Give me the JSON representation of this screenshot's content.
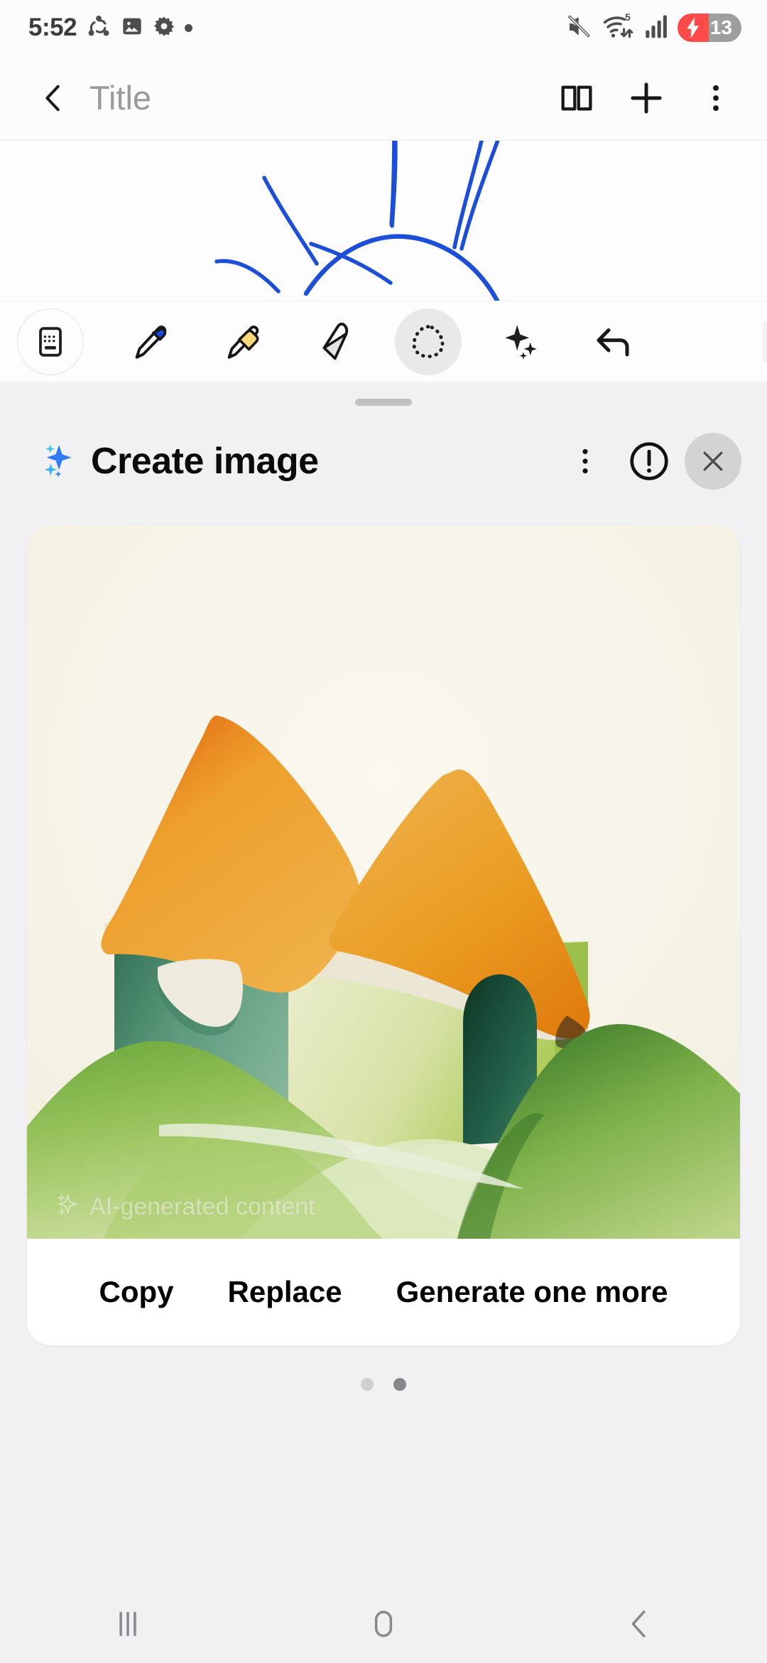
{
  "status_bar": {
    "time": "5:52",
    "left_icons": [
      "share-nodes-icon",
      "gallery-image-icon",
      "settings-gear-icon",
      "dot-indicator-icon"
    ],
    "right_icons": [
      "sound-mute-icon",
      "wifi-icon",
      "cellular-signal-icon"
    ],
    "wifi_level_label": "5",
    "battery": {
      "percent_label": "13",
      "charging": true,
      "accent": "#ff4a4a",
      "pill_bg": "#9e9e9e"
    }
  },
  "app_bar": {
    "back_icon": "chevron-left-icon",
    "title": "Title",
    "actions": [
      {
        "name": "book-view-icon",
        "label": "Book view"
      },
      {
        "name": "add-icon",
        "label": "Add"
      },
      {
        "name": "more-options-icon",
        "label": "More options"
      }
    ]
  },
  "canvas": {
    "ink_color": "#1d4ed8",
    "description": "blue pen drawing of a sun with rays"
  },
  "pen_toolbar": {
    "tools": [
      {
        "name": "keyboard-icon",
        "label": "Keyboard",
        "state": "framed"
      },
      {
        "name": "pen-icon",
        "label": "Pen",
        "color": "#1a47e8",
        "state": "normal"
      },
      {
        "name": "highlighter-icon",
        "label": "Highlighter",
        "color": "#fbd77a",
        "state": "normal"
      },
      {
        "name": "eraser-icon",
        "label": "Eraser",
        "color": "#e4e4e4",
        "state": "normal"
      },
      {
        "name": "lasso-select-icon",
        "label": "Selection",
        "state": "selected"
      },
      {
        "name": "ai-sparkle-icon",
        "label": "AI assist",
        "state": "normal"
      },
      {
        "name": "undo-icon",
        "label": "Undo",
        "state": "normal"
      }
    ]
  },
  "sheet": {
    "title": "Create image",
    "title_icon": "ai-sparkle-icon",
    "header_actions": [
      {
        "name": "more-options-icon",
        "label": "More options"
      },
      {
        "name": "info-circle-icon",
        "label": "Information"
      },
      {
        "name": "close-icon",
        "label": "Close"
      }
    ]
  },
  "result_card": {
    "watermark_text": "AI-generated content",
    "watermark_icon": "ai-sparkle-icon",
    "image_description": "Illustration of a house with an orange roof, green walls and a dark green arched door, set on rolling green hills with a cream sky",
    "image_colors": {
      "sky": "#f6f4ea",
      "roof_light": "#eca233",
      "roof_dark": "#e07a14",
      "roof_trim": "#ece6d5",
      "wall_teal": "#4e8a73",
      "wall_green": "#c9da93",
      "hill_light": "#a7cc6b",
      "hill_dark": "#4d8c3d",
      "door": "#1c5a3e",
      "window": "#eee9da"
    },
    "actions": [
      {
        "name": "copy-button",
        "label": "Copy"
      },
      {
        "name": "replace-button",
        "label": "Replace"
      },
      {
        "name": "generate-one-more-button",
        "label": "Generate one more"
      }
    ]
  },
  "page_indicator": {
    "total": 2,
    "active_index": 1
  },
  "nav_bar": {
    "buttons": [
      {
        "name": "recents-icon",
        "label": "Recents"
      },
      {
        "name": "home-icon",
        "label": "Home"
      },
      {
        "name": "back-icon",
        "label": "Back"
      }
    ]
  }
}
